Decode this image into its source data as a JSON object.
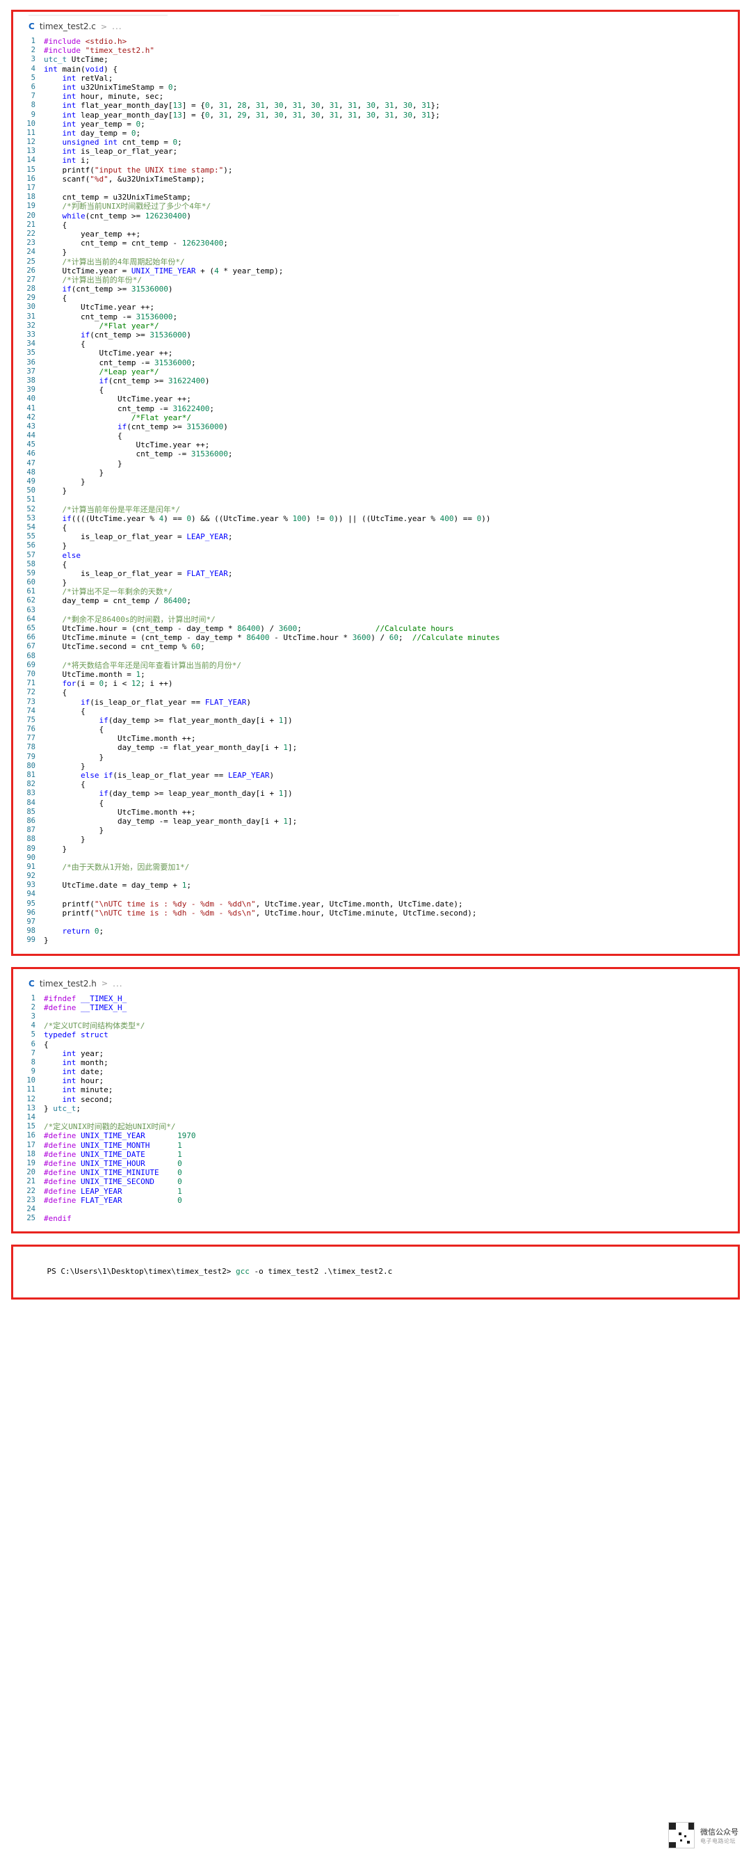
{
  "editor": {
    "c_file": {
      "breadcrumb": {
        "lang_icon": "C",
        "file_name": "timex_test2.c",
        "separator": ">",
        "ellipsis": "..."
      },
      "lines": [
        {
          "n": 1,
          "t": "#include <stdio.h>"
        },
        {
          "n": 2,
          "t": "#include \"timex_test2.h\""
        },
        {
          "n": 3,
          "t": "utc_t UtcTime;"
        },
        {
          "n": 4,
          "t": "int main(void) {"
        },
        {
          "n": 5,
          "t": "    int retVal;"
        },
        {
          "n": 6,
          "t": "    int u32UnixTimeStamp = 0;"
        },
        {
          "n": 7,
          "t": "    int hour, minute, sec;"
        },
        {
          "n": 8,
          "t": "    int flat_year_month_day[13] = {0, 31, 28, 31, 30, 31, 30, 31, 31, 30, 31, 30, 31};"
        },
        {
          "n": 9,
          "t": "    int leap_year_month_day[13] = {0, 31, 29, 31, 30, 31, 30, 31, 31, 30, 31, 30, 31};"
        },
        {
          "n": 10,
          "t": "    int year_temp = 0;"
        },
        {
          "n": 11,
          "t": "    int day_temp = 0;"
        },
        {
          "n": 12,
          "t": "    unsigned int cnt_temp = 0;"
        },
        {
          "n": 13,
          "t": "    int is_leap_or_flat_year;"
        },
        {
          "n": 14,
          "t": "    int i;"
        },
        {
          "n": 15,
          "t": "    printf(\"input the UNIX time stamp:\");"
        },
        {
          "n": 16,
          "t": "    scanf(\"%d\", &u32UnixTimeStamp);"
        },
        {
          "n": 17,
          "t": ""
        },
        {
          "n": 18,
          "t": "    cnt_temp = u32UnixTimeStamp;"
        },
        {
          "n": 19,
          "t": "    /*判断当前UNIX时间戳经过了多少个4年*/"
        },
        {
          "n": 20,
          "t": "    while(cnt_temp >= 126230400)"
        },
        {
          "n": 21,
          "t": "    {"
        },
        {
          "n": 22,
          "t": "        year_temp ++;"
        },
        {
          "n": 23,
          "t": "        cnt_temp = cnt_temp - 126230400;"
        },
        {
          "n": 24,
          "t": "    }"
        },
        {
          "n": 25,
          "t": "    /*计算出当前的4年周期起始年份*/"
        },
        {
          "n": 26,
          "t": "    UtcTime.year = UNIX_TIME_YEAR + (4 * year_temp);"
        },
        {
          "n": 27,
          "t": "    /*计算出当前的年份*/"
        },
        {
          "n": 28,
          "t": "    if(cnt_temp >= 31536000)"
        },
        {
          "n": 29,
          "t": "    {"
        },
        {
          "n": 30,
          "t": "        UtcTime.year ++;"
        },
        {
          "n": 31,
          "t": "        cnt_temp -= 31536000;"
        },
        {
          "n": 32,
          "t": "            /*Flat year*/"
        },
        {
          "n": 33,
          "t": "        if(cnt_temp >= 31536000)"
        },
        {
          "n": 34,
          "t": "        {"
        },
        {
          "n": 35,
          "t": "            UtcTime.year ++;"
        },
        {
          "n": 36,
          "t": "            cnt_temp -= 31536000;"
        },
        {
          "n": 37,
          "t": "            /*Leap year*/"
        },
        {
          "n": 38,
          "t": "            if(cnt_temp >= 31622400)"
        },
        {
          "n": 39,
          "t": "            {"
        },
        {
          "n": 40,
          "t": "                UtcTime.year ++;"
        },
        {
          "n": 41,
          "t": "                cnt_temp -= 31622400;"
        },
        {
          "n": 42,
          "t": "                   /*Flat year*/"
        },
        {
          "n": 43,
          "t": "                if(cnt_temp >= 31536000)"
        },
        {
          "n": 44,
          "t": "                {"
        },
        {
          "n": 45,
          "t": "                    UtcTime.year ++;"
        },
        {
          "n": 46,
          "t": "                    cnt_temp -= 31536000;"
        },
        {
          "n": 47,
          "t": "                }"
        },
        {
          "n": 48,
          "t": "            }"
        },
        {
          "n": 49,
          "t": "        }"
        },
        {
          "n": 50,
          "t": "    }"
        },
        {
          "n": 51,
          "t": ""
        },
        {
          "n": 52,
          "t": "    /*计算当前年份是平年还是闰年*/"
        },
        {
          "n": 53,
          "t": "    if((((UtcTime.year % 4) == 0) && ((UtcTime.year % 100) != 0)) || ((UtcTime.year % 400) == 0))"
        },
        {
          "n": 54,
          "t": "    {"
        },
        {
          "n": 55,
          "t": "        is_leap_or_flat_year = LEAP_YEAR;"
        },
        {
          "n": 56,
          "t": "    }"
        },
        {
          "n": 57,
          "t": "    else"
        },
        {
          "n": 58,
          "t": "    {"
        },
        {
          "n": 59,
          "t": "        is_leap_or_flat_year = FLAT_YEAR;"
        },
        {
          "n": 60,
          "t": "    }"
        },
        {
          "n": 61,
          "t": "    /*计算出不足一年剩余的天数*/"
        },
        {
          "n": 62,
          "t": "    day_temp = cnt_temp / 86400;"
        },
        {
          "n": 63,
          "t": ""
        },
        {
          "n": 64,
          "t": "    /*剩余不足86400s的时间戳，计算出时间*/"
        },
        {
          "n": 65,
          "t": "    UtcTime.hour = (cnt_temp - day_temp * 86400) / 3600;                //Calculate hours"
        },
        {
          "n": 66,
          "t": "    UtcTime.minute = (cnt_temp - day_temp * 86400 - UtcTime.hour * 3600) / 60;  //Calculate minutes"
        },
        {
          "n": 67,
          "t": "    UtcTime.second = cnt_temp % 60;"
        },
        {
          "n": 68,
          "t": ""
        },
        {
          "n": 69,
          "t": "    /*将天数结合平年还是闰年查看计算出当前的月份*/"
        },
        {
          "n": 70,
          "t": "    UtcTime.month = 1;"
        },
        {
          "n": 71,
          "t": "    for(i = 0; i < 12; i ++)"
        },
        {
          "n": 72,
          "t": "    {"
        },
        {
          "n": 73,
          "t": "        if(is_leap_or_flat_year == FLAT_YEAR)"
        },
        {
          "n": 74,
          "t": "        {"
        },
        {
          "n": 75,
          "t": "            if(day_temp >= flat_year_month_day[i + 1])"
        },
        {
          "n": 76,
          "t": "            {"
        },
        {
          "n": 77,
          "t": "                UtcTime.month ++;"
        },
        {
          "n": 78,
          "t": "                day_temp -= flat_year_month_day[i + 1];"
        },
        {
          "n": 79,
          "t": "            }"
        },
        {
          "n": 80,
          "t": "        }"
        },
        {
          "n": 81,
          "t": "        else if(is_leap_or_flat_year == LEAP_YEAR)"
        },
        {
          "n": 82,
          "t": "        {"
        },
        {
          "n": 83,
          "t": "            if(day_temp >= leap_year_month_day[i + 1])"
        },
        {
          "n": 84,
          "t": "            {"
        },
        {
          "n": 85,
          "t": "                UtcTime.month ++;"
        },
        {
          "n": 86,
          "t": "                day_temp -= leap_year_month_day[i + 1];"
        },
        {
          "n": 87,
          "t": "            }"
        },
        {
          "n": 88,
          "t": "        }"
        },
        {
          "n": 89,
          "t": "    }"
        },
        {
          "n": 90,
          "t": ""
        },
        {
          "n": 91,
          "t": "    /*由于天数从1开始，因此需要加1*/"
        },
        {
          "n": 92,
          "t": ""
        },
        {
          "n": 93,
          "t": "    UtcTime.date = day_temp + 1;"
        },
        {
          "n": 94,
          "t": ""
        },
        {
          "n": 95,
          "t": "    printf(\"\\nUTC time is : %dy - %dm - %dd\\n\", UtcTime.year, UtcTime.month, UtcTime.date);"
        },
        {
          "n": 96,
          "t": "    printf(\"\\nUTC time is : %dh - %dm - %ds\\n\", UtcTime.hour, UtcTime.minute, UtcTime.second);"
        },
        {
          "n": 97,
          "t": ""
        },
        {
          "n": 98,
          "t": "    return 0;"
        },
        {
          "n": 99,
          "t": "}"
        }
      ]
    },
    "h_file": {
      "breadcrumb": {
        "lang_icon": "C",
        "file_name": "timex_test2.h",
        "separator": ">",
        "ellipsis": "..."
      },
      "lines": [
        {
          "n": 1,
          "t": "#ifndef __TIMEX_H_"
        },
        {
          "n": 2,
          "t": "#define __TIMEX_H_"
        },
        {
          "n": 3,
          "t": ""
        },
        {
          "n": 4,
          "t": "/*定义UTC时间结构体类型*/"
        },
        {
          "n": 5,
          "t": "typedef struct"
        },
        {
          "n": 6,
          "t": "{"
        },
        {
          "n": 7,
          "t": "    int year;"
        },
        {
          "n": 8,
          "t": "    int month;"
        },
        {
          "n": 9,
          "t": "    int date;"
        },
        {
          "n": 10,
          "t": "    int hour;"
        },
        {
          "n": 11,
          "t": "    int minute;"
        },
        {
          "n": 12,
          "t": "    int second;"
        },
        {
          "n": 13,
          "t": "} utc_t;"
        },
        {
          "n": 14,
          "t": ""
        },
        {
          "n": 15,
          "t": "/*定义UNIX时间戳的起始UNIX时间*/"
        },
        {
          "n": 16,
          "t": "#define UNIX_TIME_YEAR       1970"
        },
        {
          "n": 17,
          "t": "#define UNIX_TIME_MONTH      1"
        },
        {
          "n": 18,
          "t": "#define UNIX_TIME_DATE       1"
        },
        {
          "n": 19,
          "t": "#define UNIX_TIME_HOUR       0"
        },
        {
          "n": 20,
          "t": "#define UNIX_TIME_MINIUTE    0"
        },
        {
          "n": 21,
          "t": "#define UNIX_TIME_SECOND     0"
        },
        {
          "n": 22,
          "t": "#define LEAP_YEAR            1"
        },
        {
          "n": 23,
          "t": "#define FLAT_YEAR            0"
        },
        {
          "n": 24,
          "t": ""
        },
        {
          "n": 25,
          "t": "#endif"
        }
      ]
    }
  },
  "terminal": {
    "prompt": "PS C:\\Users\\1\\Desktop\\timex\\timex_test2>",
    "command_program": "gcc",
    "command_args": "-o timex_test2 .\\timex_test2.c"
  },
  "watermark": {
    "line1": "微信公众号",
    "line2": "电子电路论坛"
  },
  "colors": {
    "panel_border": "#e8241f",
    "keyword": "#0000ff",
    "number": "#098658",
    "string": "#a31515",
    "comment": "#008000",
    "comment_cjk": "#6a9955",
    "macro": "#0000ff",
    "linenumber": "#237893",
    "background": "#ffffff"
  }
}
